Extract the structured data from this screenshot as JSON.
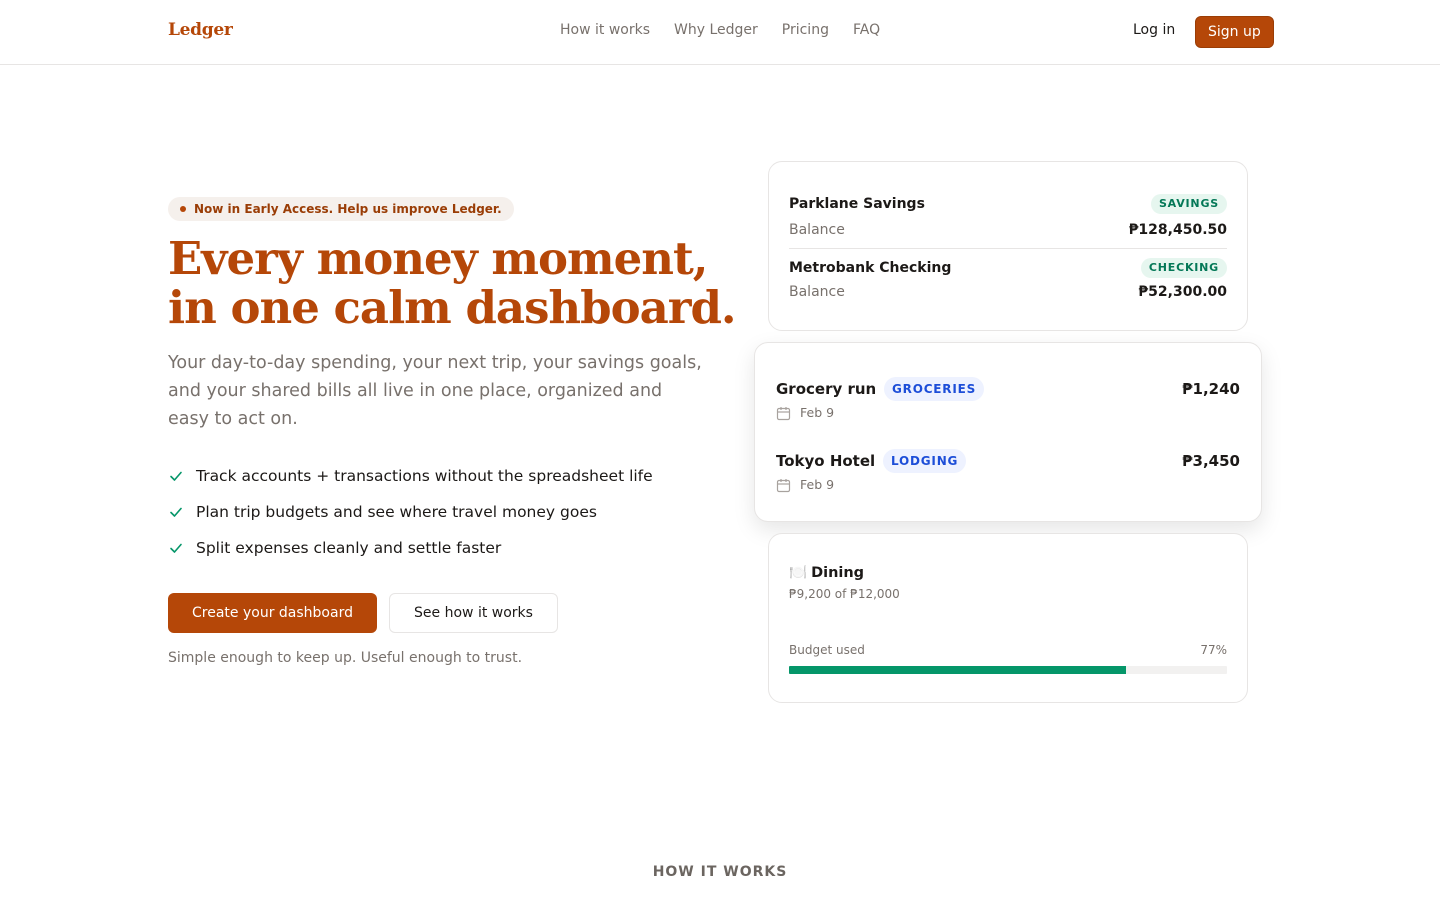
{
  "header": {
    "brand": "Ledger",
    "nav": [
      "How it works",
      "Why Ledger",
      "Pricing",
      "FAQ"
    ],
    "login": "Log in",
    "signup": "Sign up"
  },
  "hero": {
    "pill": "Now in Early Access. Help us improve Ledger.",
    "headline_line1": "Every money moment,",
    "headline_line2": "in one calm dashboard.",
    "subtext": "Your day-to-day spending, your next trip, your savings goals, and your shared bills all live in one place, organized and easy to act on.",
    "features": [
      "Track accounts + transactions without the spreadsheet life",
      "Plan trip budgets and see where travel money goes",
      "Split expenses cleanly and settle faster"
    ],
    "cta_primary": "Create your dashboard",
    "cta_secondary": "See how it works",
    "tagline": "Simple enough to keep up. Useful enough to trust."
  },
  "accounts": [
    {
      "name": "Parklane Savings",
      "type": "SAVINGS",
      "label": "Balance",
      "balance": "₱128,450.50"
    },
    {
      "name": "Metrobank Checking",
      "type": "CHECKING",
      "label": "Balance",
      "balance": "₱52,300.00"
    }
  ],
  "transactions": [
    {
      "title": "Grocery run",
      "category": "GROCERIES",
      "date": "Feb 9",
      "amount": "₱1,240"
    },
    {
      "title": "Tokyo Hotel",
      "category": "LODGING",
      "date": "Feb 9",
      "amount": "₱3,450"
    }
  ],
  "budget": {
    "emoji": "🍽️",
    "category": "Dining",
    "summary": "₱9,200 of ₱12,000",
    "used_label": "Budget used",
    "used_pct_label": "77%",
    "used_fraction": 0.77
  },
  "sections": {
    "how_it_works_label": "HOW IT WORKS"
  },
  "colors": {
    "brand": "#b54708",
    "success": "#059669",
    "badge_green_bg": "#e6f6ef",
    "badge_blue_bg": "#eef2ff"
  },
  "icons": {
    "check": "check-icon",
    "calendar": "calendar-icon"
  }
}
